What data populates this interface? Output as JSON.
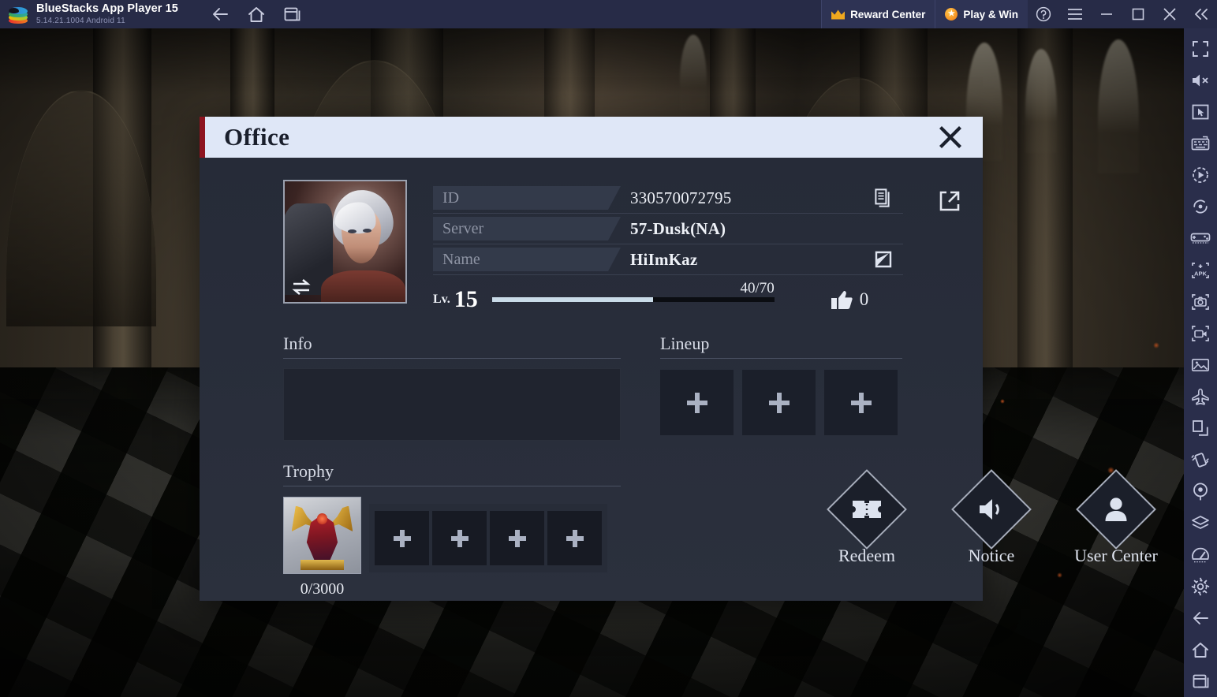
{
  "bluestacks": {
    "logo_icon": "bluestacks-layers-icon",
    "title": "BlueStacks App Player 15",
    "version": "5.14.21.1004   Android 11",
    "nav": [
      {
        "name": "back",
        "icon": "arrow-left-icon"
      },
      {
        "name": "home",
        "icon": "home-icon"
      },
      {
        "name": "recents",
        "icon": "recents-icon"
      }
    ],
    "reward_center": {
      "label": "Reward Center",
      "icon": "crown-icon"
    },
    "play_win": {
      "label": "Play & Win",
      "icon": "star-badge-icon"
    },
    "window_buttons": [
      {
        "name": "help",
        "icon": "question-circle-icon"
      },
      {
        "name": "menu",
        "icon": "hamburger-icon"
      },
      {
        "name": "minimize",
        "icon": "minimize-icon"
      },
      {
        "name": "maximize",
        "icon": "maximize-icon"
      },
      {
        "name": "close",
        "icon": "close-icon"
      },
      {
        "name": "collapse-sidebar",
        "icon": "chevron-double-left-icon"
      }
    ]
  },
  "sidebar": {
    "items": [
      {
        "name": "fullscreen",
        "icon": "fullscreen-icon"
      },
      {
        "name": "mute",
        "icon": "speaker-mute-icon"
      },
      {
        "name": "cursor",
        "icon": "cursor-box-icon"
      },
      {
        "name": "keyboard-controls",
        "icon": "keyboard-icon"
      },
      {
        "name": "macro-recorder",
        "icon": "play-circle-icon"
      },
      {
        "name": "rotate",
        "icon": "rotate-icon"
      },
      {
        "name": "gamepad",
        "icon": "gamepad-icon"
      },
      {
        "name": "install-apk",
        "icon": "apk-icon"
      },
      {
        "name": "screenshot",
        "icon": "camera-icon"
      },
      {
        "name": "record-screen",
        "icon": "video-camera-icon"
      },
      {
        "name": "media-manager",
        "icon": "image-gallery-icon"
      },
      {
        "name": "eco-mode",
        "icon": "airplane-icon"
      },
      {
        "name": "multi-instance",
        "icon": "copy-windows-icon"
      },
      {
        "name": "shake",
        "icon": "shake-icon"
      },
      {
        "name": "location",
        "icon": "location-pin-icon"
      },
      {
        "name": "layers",
        "icon": "layers-icon"
      },
      {
        "name": "performance",
        "icon": "gauge-icon"
      },
      {
        "name": "settings",
        "icon": "gear-icon"
      },
      {
        "name": "android-back",
        "icon": "arrow-left-icon"
      },
      {
        "name": "android-home",
        "icon": "home-icon"
      },
      {
        "name": "android-recents",
        "icon": "recents-icon"
      }
    ]
  },
  "dialog": {
    "title": "Office",
    "close_icon": "close-icon",
    "profile": {
      "avatar_icon": "character-portrait",
      "avatar_swap_icon": "swap-arrows-icon",
      "rows": [
        {
          "label": "ID",
          "value": "330570072795",
          "icon": "copy-icon"
        },
        {
          "label": "Server",
          "value": "57-Dusk(NA)",
          "icon": ""
        },
        {
          "label": "Name",
          "value": "HiImKaz",
          "icon": "edit-pencil-icon"
        }
      ],
      "external_link_icon": "external-link-icon",
      "level_label": "Lv.",
      "level": "15",
      "xp_text": "40/70",
      "xp_percent": 57,
      "like_icon": "thumbs-up-icon",
      "like_count": "0"
    },
    "info": {
      "title": "Info",
      "content": ""
    },
    "lineup": {
      "title": "Lineup",
      "slots": [
        {
          "name": "lineup-slot-1",
          "icon": "plus-icon"
        },
        {
          "name": "lineup-slot-2",
          "icon": "plus-icon"
        },
        {
          "name": "lineup-slot-3",
          "icon": "plus-icon"
        }
      ]
    },
    "trophy": {
      "title": "Trophy",
      "featured": {
        "icon": "red-gold-armor-trophy",
        "count": "0/3000"
      },
      "slots": [
        {
          "name": "trophy-slot-1",
          "icon": "plus-icon"
        },
        {
          "name": "trophy-slot-2",
          "icon": "plus-icon"
        },
        {
          "name": "trophy-slot-3",
          "icon": "plus-icon"
        },
        {
          "name": "trophy-slot-4",
          "icon": "plus-icon"
        }
      ]
    },
    "actions": [
      {
        "name": "redeem",
        "label": "Redeem",
        "icon": "ticket-icon"
      },
      {
        "name": "notice",
        "label": "Notice",
        "icon": "speaker-icon"
      },
      {
        "name": "user-center",
        "label": "User Center",
        "icon": "person-icon"
      }
    ]
  },
  "colors": {
    "topbar": "#272b47",
    "sidebar": "#2a2e4b",
    "dialog_header": "#dfe7f7",
    "dialog_accent": "#8e1420",
    "dialog_body": "#262b38",
    "xp_fill": "#c9dbe8"
  }
}
